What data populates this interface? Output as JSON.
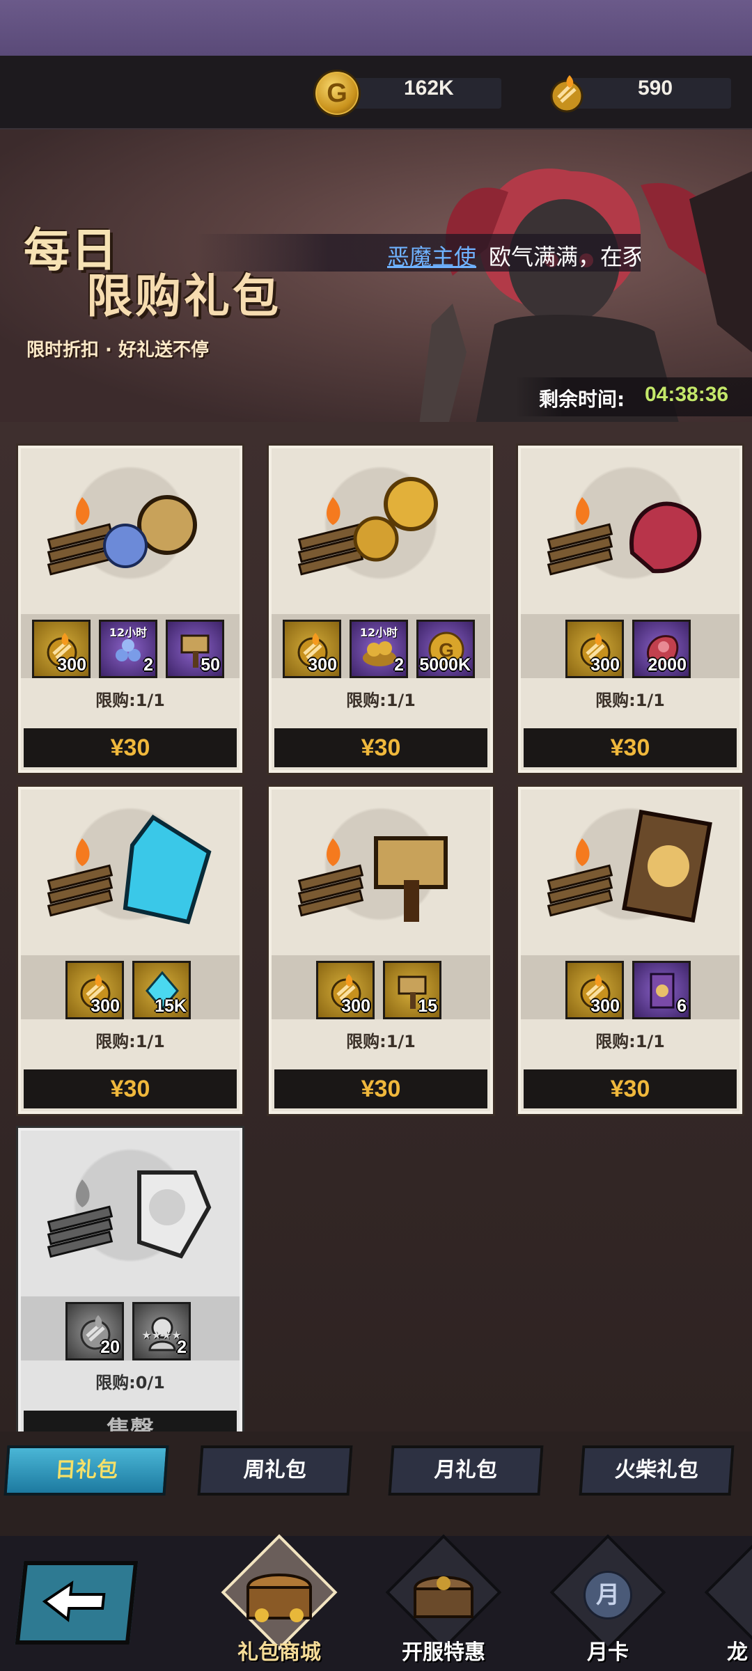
{
  "resources": {
    "gold": {
      "icon": "gold-coin-icon",
      "glyph": "G",
      "value": "162K"
    },
    "matches": {
      "icon": "match-bundle-icon",
      "value": "590"
    }
  },
  "banner": {
    "title_line1": "每日",
    "title_line2": "限购礼包",
    "subtitle": "限时折扣 · 好礼送不停",
    "marquee_link": "恶魔主使",
    "marquee_text": "欧气满满，在豕",
    "timer_label": "剩余时间:",
    "timer_value": "04:38:36"
  },
  "packs": [
    {
      "items": [
        {
          "icon": "match-fire-icon",
          "count": "300",
          "style": "gold"
        },
        {
          "icon": "blue-orbs-icon",
          "count": "2",
          "tag": "12小时",
          "style": "purple"
        },
        {
          "icon": "hammer-icon",
          "count": "50",
          "style": "purple"
        }
      ],
      "limit": "限购:1/1",
      "price": "¥30"
    },
    {
      "items": [
        {
          "icon": "match-fire-icon",
          "count": "300",
          "style": "gold"
        },
        {
          "icon": "gold-pile-icon",
          "count": "2",
          "tag": "12小时",
          "style": "purple"
        },
        {
          "icon": "gold-coin-icon",
          "count": "5000K",
          "style": "purple"
        }
      ],
      "limit": "限购:1/1",
      "price": "¥30"
    },
    {
      "items": [
        {
          "icon": "match-fire-icon",
          "count": "300",
          "style": "gold"
        },
        {
          "icon": "red-meat-icon",
          "count": "2000",
          "style": "purple"
        }
      ],
      "limit": "限购:1/1",
      "price": "¥30"
    },
    {
      "items": [
        {
          "icon": "match-fire-icon",
          "count": "300",
          "style": "gold"
        },
        {
          "icon": "blue-crystal-icon",
          "count": "15K",
          "style": "gold"
        }
      ],
      "limit": "限购:1/1",
      "price": "¥30"
    },
    {
      "items": [
        {
          "icon": "match-fire-icon",
          "count": "300",
          "style": "gold"
        },
        {
          "icon": "hammer-icon",
          "count": "15",
          "style": "gold"
        }
      ],
      "limit": "限购:1/1",
      "price": "¥30"
    },
    {
      "items": [
        {
          "icon": "match-fire-icon",
          "count": "300",
          "style": "gold"
        },
        {
          "icon": "skill-card-icon",
          "count": "6",
          "style": "purple"
        }
      ],
      "limit": "限购:1/1",
      "price": "¥30"
    },
    {
      "items": [
        {
          "icon": "match-fire-icon",
          "count": "20",
          "style": "gray"
        },
        {
          "icon": "hero-shard-icon",
          "count": "2",
          "stars": "★★★★",
          "style": "gray"
        }
      ],
      "limit": "限购:0/1",
      "price": "售罄",
      "disabled": true
    }
  ],
  "tabs": [
    "日礼包",
    "周礼包",
    "月礼包",
    "火柴礼包"
  ],
  "active_tab": 0,
  "nav": [
    {
      "label": "礼包商城",
      "icon": "treasure-chest-icon",
      "active": true
    },
    {
      "label": "开服特惠",
      "icon": "gift-chest-icon"
    },
    {
      "label": "月卡",
      "icon": "month-card-icon",
      "glyph": "月"
    },
    {
      "label": "龙",
      "icon": "dragon-icon"
    }
  ],
  "colors": {
    "price": "#f0b83c",
    "timer": "#c4e86a",
    "link": "#6fb2ff",
    "active_tab": "#2a9cc4"
  }
}
